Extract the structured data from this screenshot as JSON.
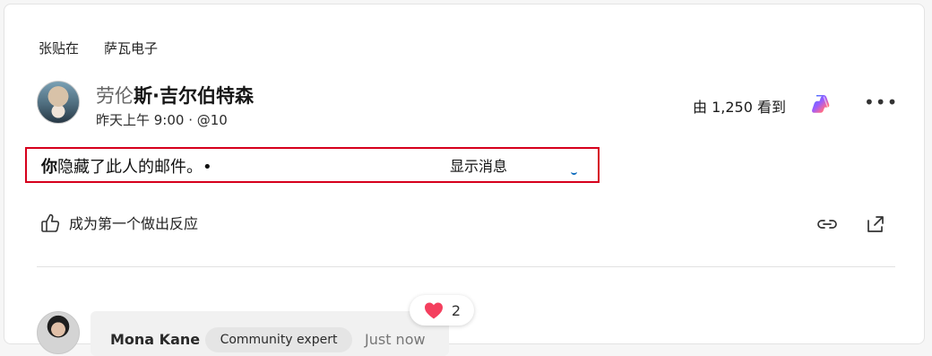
{
  "breadcrumb": {
    "items": [
      "张贴在",
      "萨瓦电子"
    ]
  },
  "post": {
    "author_light": "劳伦",
    "author_bold": "斯·吉尔伯特森",
    "timestamp": "昨天上午 9:00 · @10",
    "seen_by": "由 1,250 看到",
    "hidden_notice_bold": "你",
    "hidden_notice": "隐藏了此人的邮件。•",
    "show_message": "显示消息",
    "react_prompt": "成为第一个做出反应"
  },
  "icons": {
    "copilot": "copilot-icon",
    "more": "more-options-icon",
    "like": "thumbs-up-icon",
    "link": "link-icon",
    "share": "share-icon",
    "heart": "heart-icon"
  },
  "comment": {
    "author": "Mona Kane",
    "badge": "Community expert",
    "time": "Just now",
    "reaction_count": "2"
  },
  "colors": {
    "accent_red": "#d6001c",
    "link_blue": "#0f6cbd",
    "heart_pink": "#f43f5e"
  }
}
